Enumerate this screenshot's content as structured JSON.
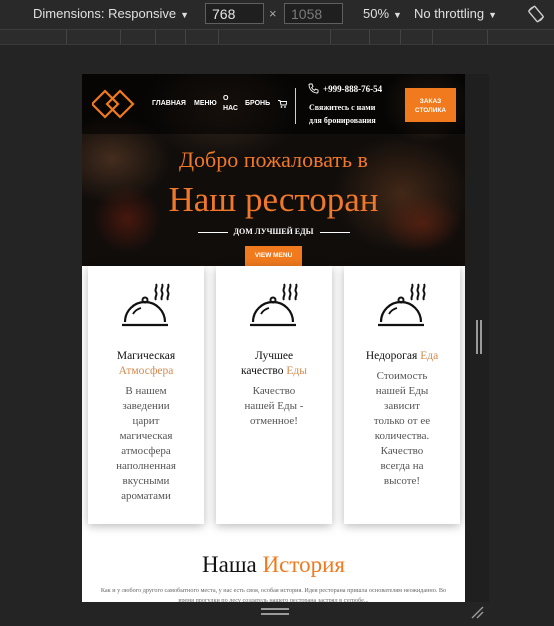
{
  "devtools": {
    "dimensions_label": "Dimensions: Responsive",
    "width_value": "768",
    "height_value": "1058",
    "times_sign": "×",
    "zoom": "50%",
    "throttling": "No throttling"
  },
  "nav": {
    "links": [
      "ГЛАВНАЯ",
      "МЕНЮ",
      "О",
      "НАС",
      "БРОНЬ"
    ],
    "phone": "+999-888-76-54",
    "contact_line1": "Свяжитесь с нами",
    "contact_line2": "для бронирования",
    "order_line1": "ЗАКАЗ",
    "order_line2": "СТОЛИКА"
  },
  "hero": {
    "welcome": "Добро пожаловать в",
    "title": "Наш ресторан",
    "subtitle": "ДОМ ЛУЧШЕЙ ЕДЫ",
    "menu_button": "VIEW MENU"
  },
  "cards": [
    {
      "title_main": "Магическая",
      "title_accent": "Атмосфера",
      "desc": "В нашем заведении царит магическая атмосфера наполненная вкусными ароматами"
    },
    {
      "title_main": "Лучшее качество",
      "title_accent": "Еды",
      "desc": "Качество нашей Еды - отменное!"
    },
    {
      "title_main": "Недорогая",
      "title_accent": "Еда",
      "desc": "Стоимость нашей Еды зависит только от ее количества. Качество всегда на высоте!"
    }
  ],
  "story": {
    "title_main": "Наша",
    "title_accent": "История",
    "text": "Как и у любого другого самобытного места, у нас есть своя, особая история. Идея ресторана пришла основателям неожиданно. Во время прогулки по лесу создатель нашего ресторана застрял в сугробе..."
  },
  "colors": {
    "accent": "#f07a1d",
    "card_accent": "#d4894d",
    "hero_bg": "#100d0b"
  }
}
